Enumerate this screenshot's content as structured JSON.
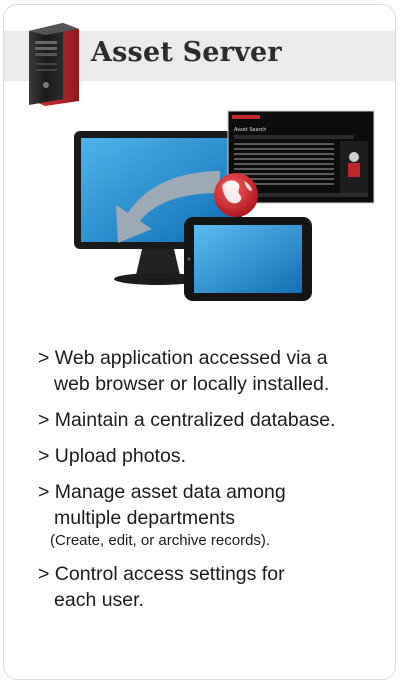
{
  "card": {
    "title": "Asset Server"
  },
  "hero": {
    "screen_heading": "Asset Search"
  },
  "features": [
    {
      "lines": [
        "> Web application accessed via a",
        "web browser or locally installed."
      ],
      "note": ""
    },
    {
      "lines": [
        "> Maintain a centralized database."
      ],
      "note": ""
    },
    {
      "lines": [
        "> Upload photos."
      ],
      "note": ""
    },
    {
      "lines": [
        "> Manage asset data among",
        "multiple departments"
      ],
      "note": "(Create, edit, or archive records)."
    },
    {
      "lines": [
        "> Control access settings for",
        "each user."
      ],
      "note": ""
    }
  ],
  "colors": {
    "server_red": "#c0272d",
    "monitor_blue": "#1d8fd6",
    "arrow_gray": "#9ea6ad",
    "globe_red": "#d61f26"
  },
  "icons": [
    "server-tower-icon",
    "desktop-monitor-icon",
    "tablet-icon",
    "sync-arrow-icon",
    "globe-icon"
  ]
}
